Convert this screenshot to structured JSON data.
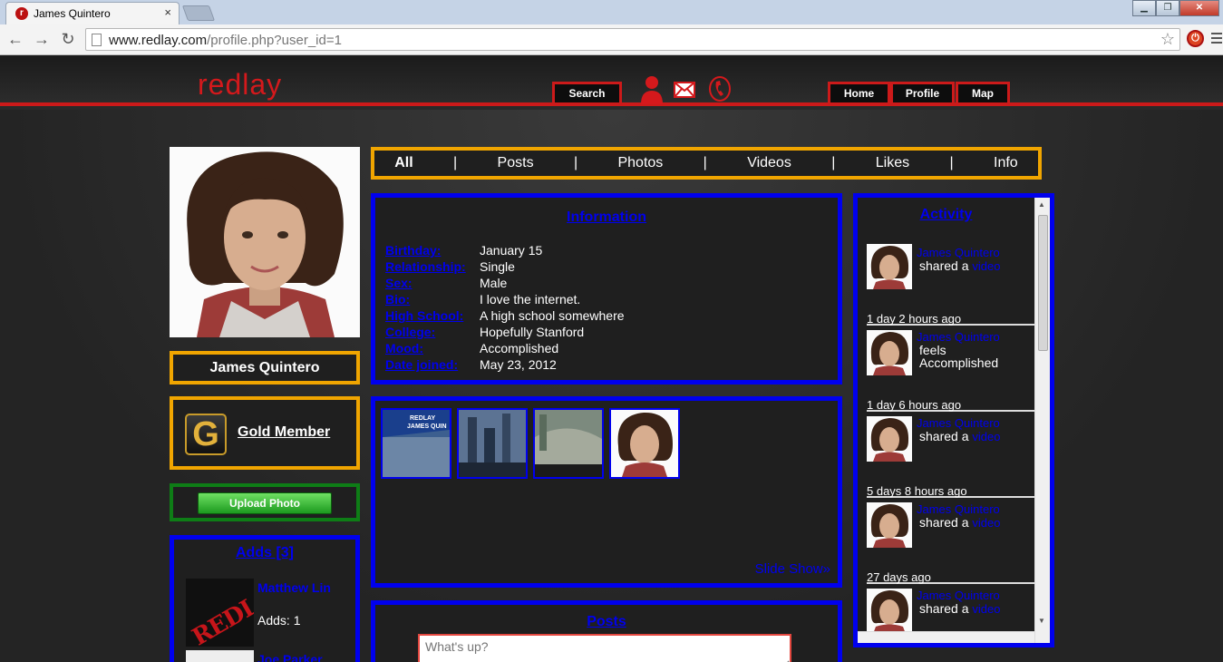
{
  "browser": {
    "tab_title": "James Quintero",
    "tab_close": "×",
    "url_domain": "www.redlay.com",
    "url_path": "/profile.php?user_id=1",
    "back": "←",
    "forward": "→",
    "reload": "↻",
    "star": "☆"
  },
  "header": {
    "logo": "redlay",
    "search_label": "Search",
    "home_label": "Home",
    "profile_label": "Profile",
    "map_label": "Map",
    "icons": [
      "user-icon",
      "mail-icon",
      "phone-icon"
    ]
  },
  "profile": {
    "name": "James Quintero",
    "membership_letter": "G",
    "membership": "Gold Member",
    "upload_label": "Upload Photo"
  },
  "adds": {
    "title": "Adds [3]",
    "items": [
      {
        "name": "Matthew Lin",
        "count": "Adds: 1",
        "thumb_text": "REDLAY"
      },
      {
        "name": "Joe Parker"
      }
    ]
  },
  "tabs": [
    {
      "label": "All"
    },
    {
      "label": "Posts"
    },
    {
      "label": "Photos"
    },
    {
      "label": "Videos"
    },
    {
      "label": "Likes"
    },
    {
      "label": "Info"
    }
  ],
  "tab_separator": "|",
  "information": {
    "title": "Information",
    "rows": [
      {
        "k": "Birthday:",
        "v": "January 15"
      },
      {
        "k": "Relationship:",
        "v": "Single"
      },
      {
        "k": "Sex:",
        "v": "Male"
      },
      {
        "k": "Bio:",
        "v": "I love the internet."
      },
      {
        "k": "High School:",
        "v": "A high school somewhere"
      },
      {
        "k": "College:",
        "v": "Hopefully Stanford"
      },
      {
        "k": "Mood:",
        "v": "Accomplished"
      },
      {
        "k": "Date joined:",
        "v": "May 23, 2012"
      }
    ]
  },
  "photos": {
    "slideshow_label": "Slide Show»",
    "thumb1_text": "REDLAY\nJAMES QUIN"
  },
  "posts": {
    "title": "Posts",
    "placeholder": "What's up?"
  },
  "activity": {
    "title": "Activity",
    "items": [
      {
        "when": "",
        "who": "James Quintero",
        "action": "shared a ",
        "link": "video"
      },
      {
        "when": "1 day 2 hours ago",
        "who": "James Quintero",
        "action": "feels",
        "line2": "Accomplished"
      },
      {
        "when": "1 day 6 hours ago",
        "who": "James Quintero",
        "action": "shared a ",
        "link": "video"
      },
      {
        "when": "5 days 8 hours ago",
        "who": "James Quintero",
        "action": "shared a ",
        "link": "video"
      },
      {
        "when": "27 days ago",
        "who": "James Quintero",
        "action": "shared a ",
        "link": "video"
      }
    ]
  },
  "colors": {
    "brand_red": "#cc1a1a",
    "box_yellow": "#f0a500",
    "box_blue": "#0000ee",
    "box_green": "#0e7d16"
  }
}
